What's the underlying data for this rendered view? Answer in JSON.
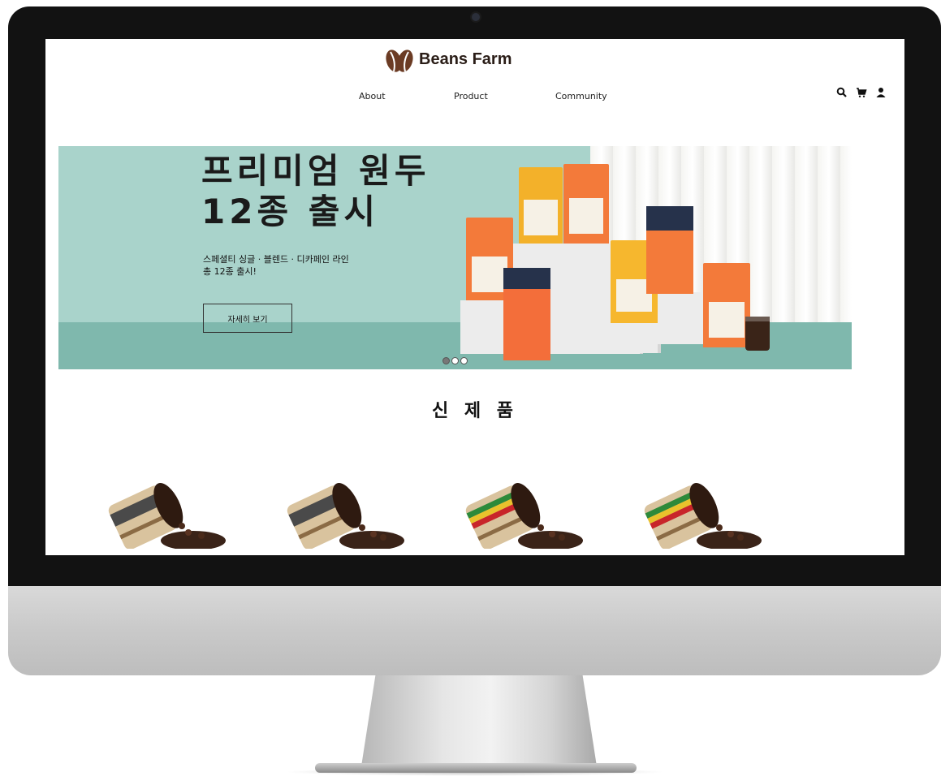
{
  "brand": {
    "name": "Beans Farm",
    "logo_icon": "coffee-bean-logo-icon",
    "color": "#6b3b24"
  },
  "nav": {
    "items": [
      "About",
      "Product",
      "Community"
    ]
  },
  "header_icons": [
    "search-icon",
    "cart-icon",
    "user-icon"
  ],
  "banner": {
    "headline_line1": "프리미엄 원두",
    "headline_line2": "12종 출시",
    "sub_line1": "스페셜티 싱글 · 블렌드 · 디카페인 라인",
    "sub_line2": "총 12종 출시!",
    "cta_label": "자세히 보기",
    "slides": 3,
    "active_slide": 1,
    "background": "#a9d3cb"
  },
  "new_products": {
    "title": "신 제 품",
    "count_visible": 4
  }
}
